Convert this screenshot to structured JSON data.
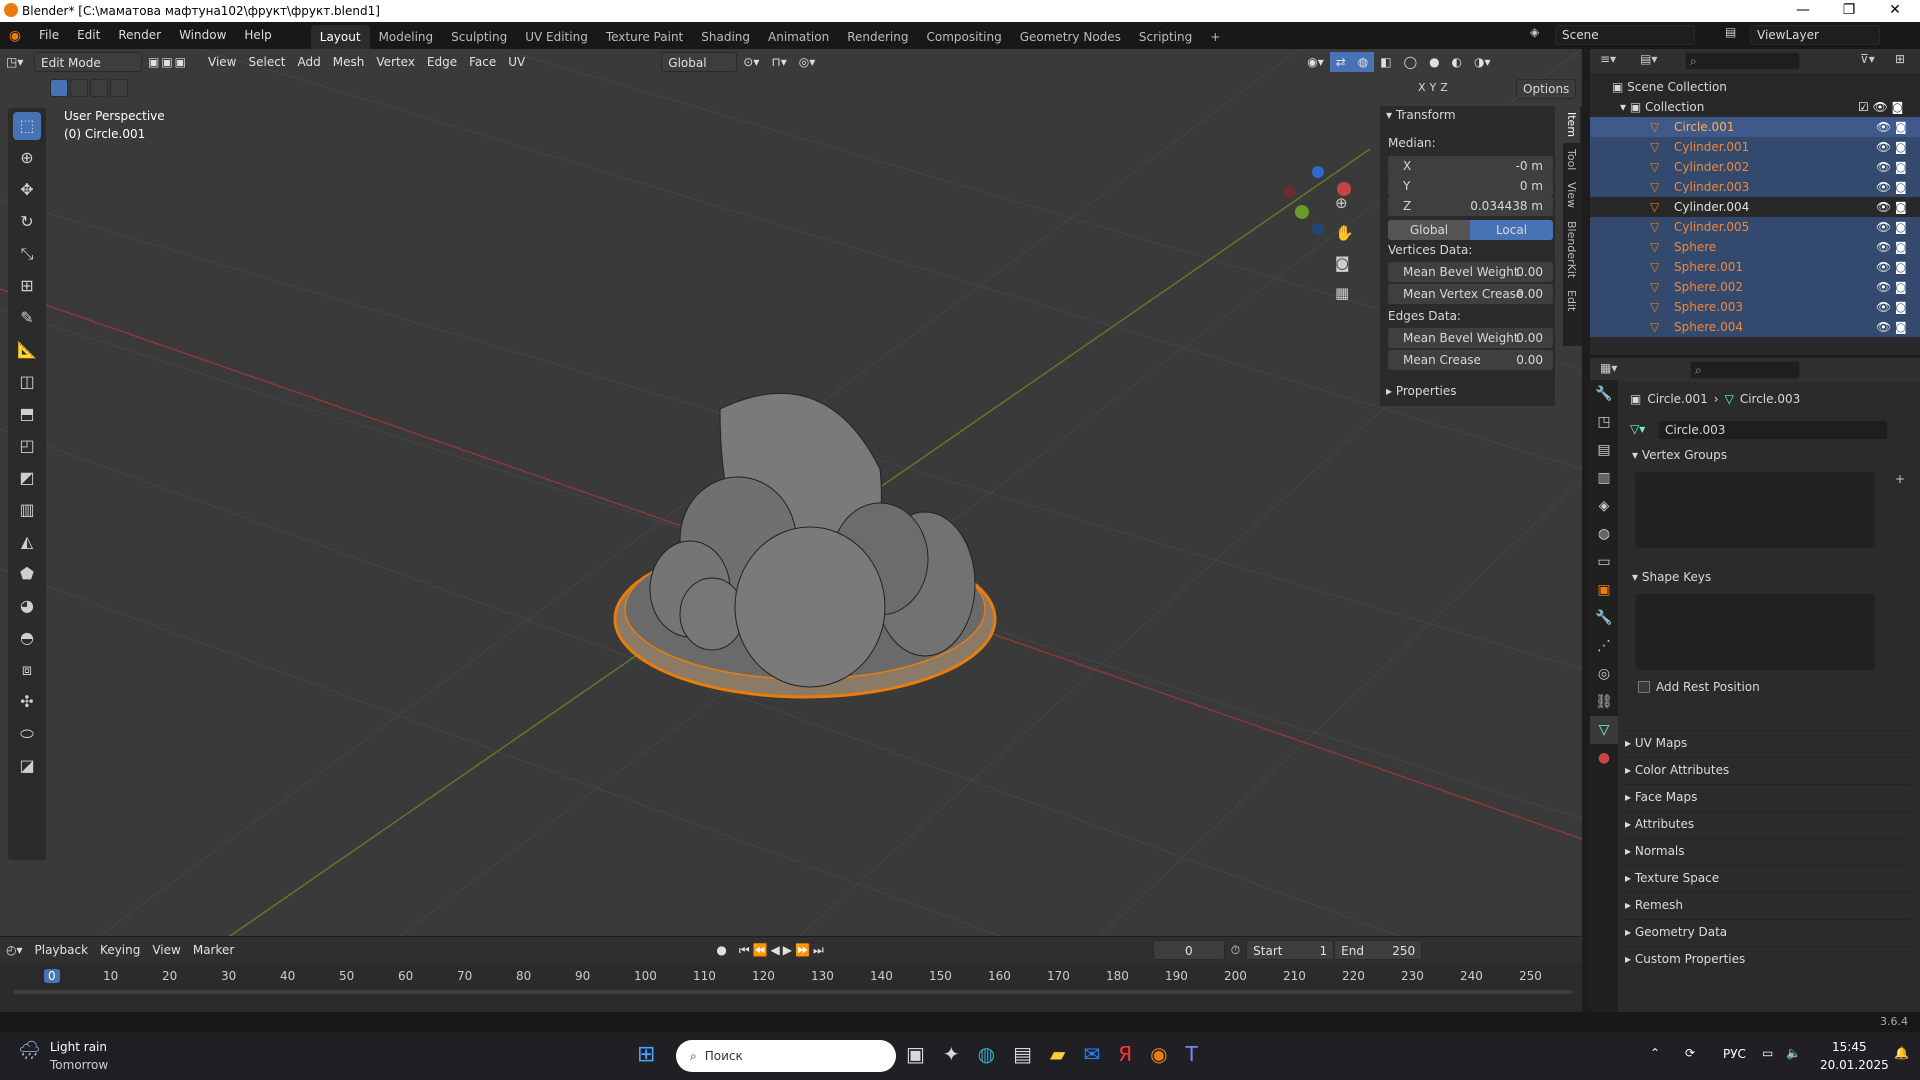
{
  "titlebar": {
    "title": "Blender* [C:\\маматова мафтуна102\\фрукт\\фрукт.blend1]"
  },
  "menu": [
    "File",
    "Edit",
    "Render",
    "Window",
    "Help"
  ],
  "workspaces": [
    "Layout",
    "Modeling",
    "Sculpting",
    "UV Editing",
    "Texture Paint",
    "Shading",
    "Animation",
    "Rendering",
    "Compositing",
    "Geometry Nodes",
    "Scripting"
  ],
  "scene": {
    "label": "Scene",
    "viewlayer": "ViewLayer"
  },
  "viewport_header": {
    "mode": "Edit Mode",
    "menus": [
      "View",
      "Select",
      "Add",
      "Mesh",
      "Vertex",
      "Edge",
      "Face",
      "UV"
    ],
    "orientation": "Global",
    "options": "Options",
    "axes": [
      "X",
      "Y",
      "Z"
    ]
  },
  "viewport": {
    "perspective": "User Perspective",
    "object": "(0) Circle.001"
  },
  "npanel": {
    "title": "Transform",
    "median": "Median:",
    "fields": [
      {
        "label": "X",
        "value": "-0 m"
      },
      {
        "label": "Y",
        "value": "0 m"
      },
      {
        "label": "Z",
        "value": "0.034438 m"
      }
    ],
    "space": [
      "Global",
      "Local"
    ],
    "vertices_data": "Vertices Data:",
    "vertex_fields": [
      {
        "label": "Mean Bevel Weight",
        "value": "0.00"
      },
      {
        "label": "Mean Vertex Crease",
        "value": "0.00"
      }
    ],
    "edges_data": "Edges Data:",
    "edge_fields": [
      {
        "label": "Mean Bevel Weight",
        "value": "0.00"
      },
      {
        "label": "Mean Crease",
        "value": "0.00"
      }
    ],
    "properties": "Properties",
    "tabs": [
      "Item",
      "Tool",
      "View",
      "BlenderKit",
      "Edit"
    ]
  },
  "outliner": {
    "scene_collection": "Scene Collection",
    "collection": "Collection",
    "items": [
      "Circle.001",
      "Cylinder.001",
      "Cylinder.002",
      "Cylinder.003",
      "Cylinder.004",
      "Cylinder.005",
      "Sphere",
      "Sphere.001",
      "Sphere.002",
      "Sphere.003",
      "Sphere.004"
    ]
  },
  "properties": {
    "breadcrumb_object": "Circle.001",
    "breadcrumb_mesh": "Circle.003",
    "mesh_name": "Circle.003",
    "vertex_groups": "Vertex Groups",
    "shape_keys": "Shape Keys",
    "add_rest_position": "Add Rest Position",
    "sections": [
      "UV Maps",
      "Color Attributes",
      "Face Maps",
      "Attributes",
      "Normals",
      "Texture Space",
      "Remesh",
      "Geometry Data",
      "Custom Properties"
    ]
  },
  "timeline": {
    "menus": [
      "Playback",
      "Keying",
      "View",
      "Marker"
    ],
    "current_frame": "0",
    "start_label": "Start",
    "start": "1",
    "end_label": "End",
    "end": "250",
    "ticks": [
      "0",
      "10",
      "20",
      "30",
      "40",
      "50",
      "60",
      "70",
      "80",
      "90",
      "100",
      "110",
      "120",
      "130",
      "140",
      "150",
      "160",
      "170",
      "180",
      "190",
      "200",
      "210",
      "220",
      "230",
      "240",
      "250"
    ]
  },
  "statusbar": {
    "version": "3.6.4"
  },
  "taskbar": {
    "weather_title": "Light rain",
    "weather_sub": "Tomorrow",
    "search": "Поиск",
    "lang": "РУС",
    "time": "15:45",
    "date": "20.01.2025"
  },
  "colors": {
    "accent": "#4772b3",
    "selected": "#e87d0d",
    "orange_text": "#f0883a",
    "viewport_bg": "#3a3a3a"
  }
}
